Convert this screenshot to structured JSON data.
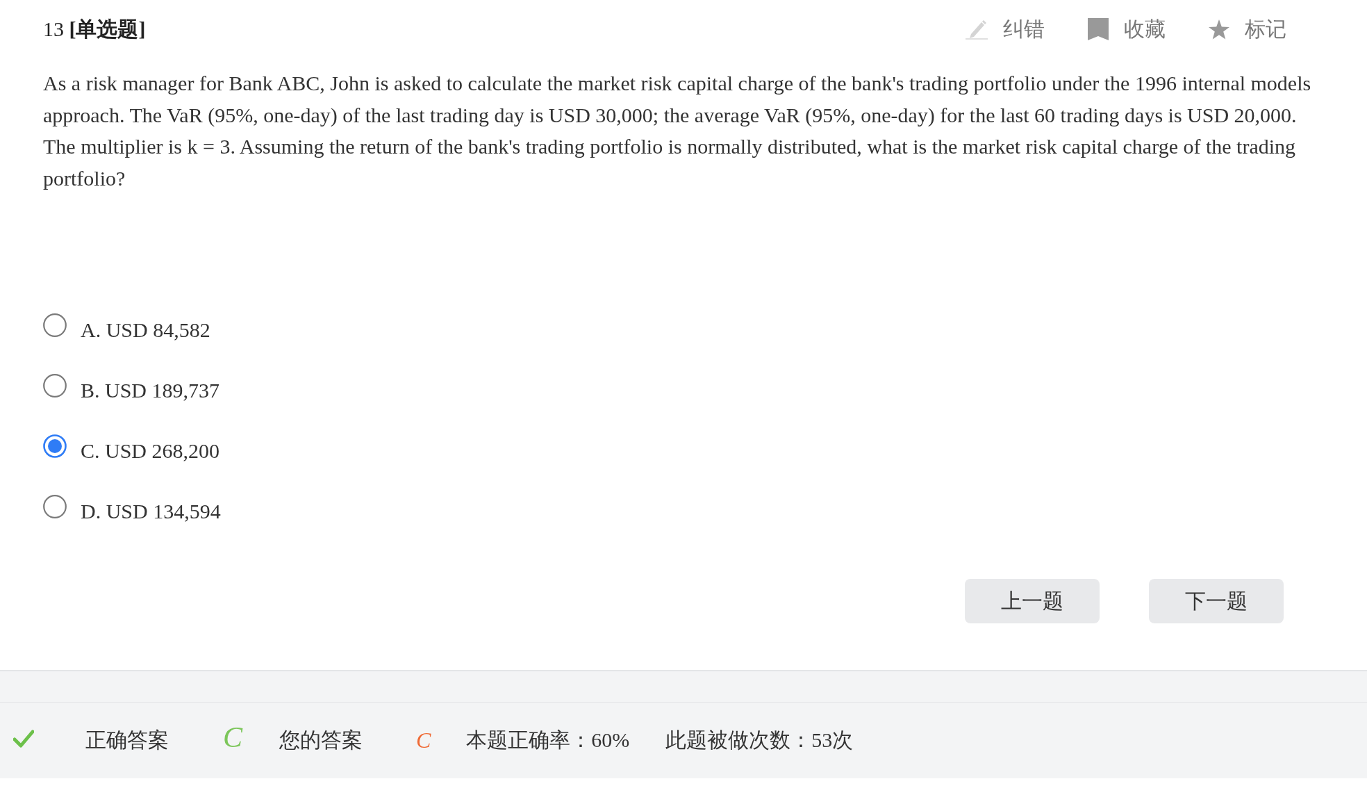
{
  "header": {
    "title": "13 **[单选题]**",
    "actions": [
      "纠错",
      "收藏",
      "标记"
    ]
  },
  "question_text": "As a risk manager for Bank ABC, John is asked to calculate the market risk capital charge of the bank's trading portfolio under the 1996 internal models approach. The VaR (95%, one-day) of the last trading day is USD 30,000; the average VaR (95%, one-day) for the last 60 trading days is USD 20,000. The multiplier is k = 3. Assuming the return of the bank's trading portfolio is normally distributed, what is the market risk capital charge of the trading portfolio?",
  "options": [
    {
      "label": "A. USD 84,582",
      "selected": false
    },
    {
      "label": "B. USD 189,737",
      "selected": false
    },
    {
      "label": "C. USD 268,200",
      "selected": true
    },
    {
      "label": "D. USD 134,594",
      "selected": false
    }
  ],
  "buttons": [
    "上一题",
    "下一题"
  ],
  "result": {
    "correct": true,
    "correct_answer_label": "正确答案",
    "correct_answer": "C",
    "your_answer_label": "您的答案",
    "your_answer": "C",
    "accuracy": "本题正确率：60%",
    "attempts": "此题被做次数：53次"
  }
}
